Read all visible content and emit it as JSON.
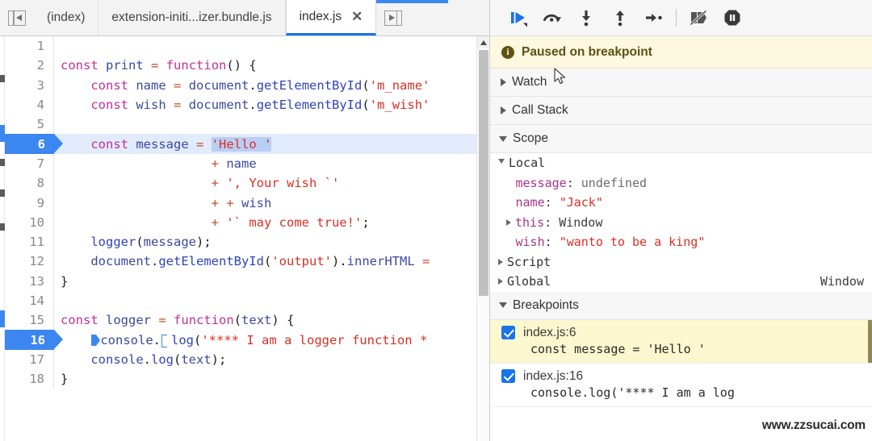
{
  "tabs": {
    "scroll_left_icon": "tab-scroll-left-icon",
    "scroll_right_icon": "tab-scroll-right-icon",
    "items": [
      {
        "label": "(index)",
        "active": false,
        "closeable": false
      },
      {
        "label": "extension-initi...izer.bundle.js",
        "active": false,
        "closeable": false
      },
      {
        "label": "index.js",
        "active": true,
        "closeable": true,
        "close_label": "✕"
      }
    ]
  },
  "editor": {
    "active_file": "index.js",
    "execution_line": 16,
    "selected_text": "'Hello '",
    "lines": [
      {
        "n": "1",
        "text": ""
      },
      {
        "n": "2",
        "text": "const print = function() {"
      },
      {
        "n": "3",
        "text": "    const name = document.getElementById('m_name'"
      },
      {
        "n": "4",
        "text": "    const wish = document.getElementById('m_wish'"
      },
      {
        "n": "5",
        "text": ""
      },
      {
        "n": "6",
        "text": "    const message = 'Hello '"
      },
      {
        "n": "7",
        "text": "                    + name"
      },
      {
        "n": "8",
        "text": "                    + ', Your wish `'"
      },
      {
        "n": "9",
        "text": "                    + + wish"
      },
      {
        "n": "10",
        "text": "                    + '` may come true!';"
      },
      {
        "n": "11",
        "text": "    logger(message);"
      },
      {
        "n": "12",
        "text": "    document.getElementById('output').innerHTML ="
      },
      {
        "n": "13",
        "text": "}"
      },
      {
        "n": "14",
        "text": ""
      },
      {
        "n": "15",
        "text": "const logger = function(text) {"
      },
      {
        "n": "16",
        "text": "    console.log('**** I am a logger function *"
      },
      {
        "n": "17",
        "text": "    console.log(text);"
      },
      {
        "n": "18",
        "text": "}"
      }
    ],
    "breakpoint_lines": [
      "6",
      "16"
    ]
  },
  "debugger": {
    "toolbar": [
      {
        "name": "resume-script-execution",
        "icon": "resume-icon"
      },
      {
        "name": "step-over-next-function-call",
        "icon": "step-over-icon"
      },
      {
        "name": "step-into-next-function-call",
        "icon": "step-into-icon"
      },
      {
        "name": "step-out-of-current-function",
        "icon": "step-out-icon"
      },
      {
        "name": "step",
        "icon": "step-icon"
      },
      {
        "name": "deactivate-breakpoints",
        "icon": "deactivate-breakpoints-icon"
      },
      {
        "name": "pause-on-exceptions",
        "icon": "pause-on-exceptions-icon"
      }
    ],
    "paused_banner": {
      "icon": "info-icon",
      "text": "Paused on breakpoint"
    },
    "sections": {
      "watch": {
        "label": "Watch",
        "expanded": false
      },
      "call_stack": {
        "label": "Call Stack",
        "expanded": false
      },
      "scope": {
        "label": "Scope",
        "expanded": true
      },
      "breakpoints": {
        "label": "Breakpoints",
        "expanded": true
      }
    },
    "scope": {
      "groups": [
        {
          "label": "Local",
          "expanded": true
        },
        {
          "label": "Script",
          "expanded": false
        },
        {
          "label": "Global",
          "expanded": false,
          "value": "Window"
        }
      ],
      "local_vars": [
        {
          "name": "message",
          "sep": ": ",
          "value": "undefined",
          "kind": "undefined",
          "expandable": false
        },
        {
          "name": "name",
          "sep": ": ",
          "value": "\"Jack\"",
          "kind": "string",
          "expandable": false
        },
        {
          "name": "this",
          "sep": ": ",
          "value": "Window",
          "kind": "object",
          "expandable": true
        },
        {
          "name": "wish",
          "sep": ": ",
          "value": "\"wanto to be a king\"",
          "kind": "string",
          "expandable": false
        }
      ]
    },
    "breakpoints": [
      {
        "checked": true,
        "location": "index.js:6",
        "snippet": "const message = 'Hello '",
        "highlighted": true
      },
      {
        "checked": true,
        "location": "index.js:16",
        "snippet": "console.log('**** I am a log",
        "highlighted": false
      }
    ]
  },
  "watermark": {
    "text": "www.zzsucai.com"
  },
  "colors": {
    "accent_blue": "#1a73e8",
    "breakpoint_blue": "#3b87ef",
    "exec_line_bg": "#e2ebfb",
    "paused_banner_bg": "#fdf8e0",
    "breakpoint_hl_bg": "#fbf7ce",
    "keyword_purple": "#c0309b",
    "string_red": "#d93025",
    "function_blue": "#2f44b8"
  }
}
